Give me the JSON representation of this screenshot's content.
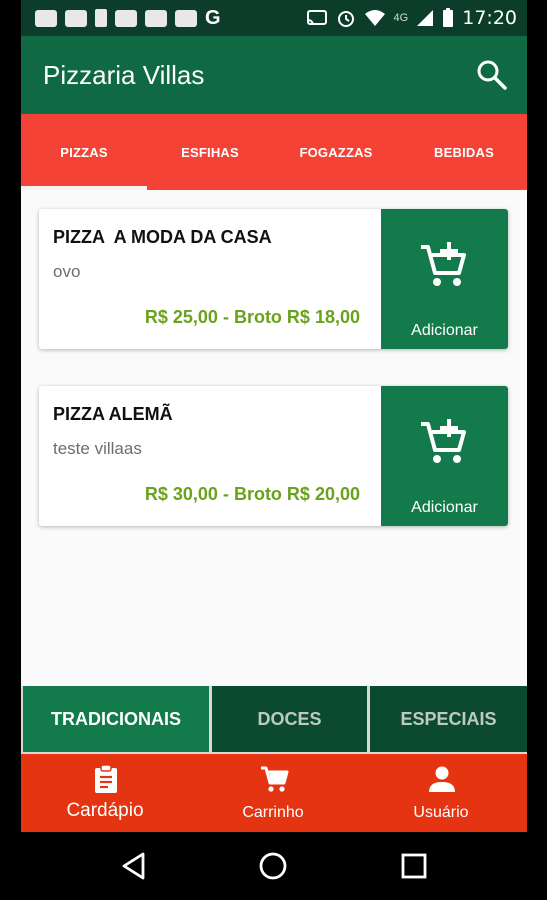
{
  "status_bar": {
    "network": "4G",
    "time": "17:20",
    "notification_letter": "G",
    "icons": [
      "message-icon",
      "news-icon",
      "phone-icon",
      "gallery-icon",
      "mail-icon",
      "gallery-icon",
      "google-icon",
      "cast-icon",
      "alarm-icon",
      "wifi-icon",
      "signal-icon",
      "battery-icon"
    ]
  },
  "app_bar": {
    "title": "Pizzaria Villas",
    "search_icon": "search-icon"
  },
  "tabs": {
    "items": [
      "PIZZAS",
      "ESFIHAS",
      "FOGAZZAS",
      "BEBIDAS"
    ],
    "selected": "PIZZAS"
  },
  "products": [
    {
      "name": "PIZZA  A MODA DA CASA",
      "description": "ovo",
      "price": "R$ 25,00 - Broto R$ 18,00",
      "action_label": "Adicionar",
      "action_icon": "add-shopping-cart-icon"
    },
    {
      "name": "PIZZA ALEMÃ",
      "description": "teste villaas",
      "price": "R$ 30,00 - Broto R$ 20,00",
      "action_label": "Adicionar",
      "action_icon": "add-shopping-cart-icon"
    }
  ],
  "categories": {
    "items": [
      "TRADICIONAIS",
      "DOCES",
      "ESPECIAIS"
    ],
    "selected": "TRADICIONAIS"
  },
  "bottom_nav": {
    "items": [
      {
        "label": "Cardápio",
        "icon": "menu-clipboard-icon"
      },
      {
        "label": "Carrinho",
        "icon": "cart-icon"
      },
      {
        "label": "Usuário",
        "icon": "user-icon"
      }
    ]
  },
  "colors": {
    "primary_dark": "#0b3d2a",
    "primary": "#0f6a44",
    "button_green": "#137a4c",
    "tab_red": "#f44336",
    "bottom_nav_red": "#e53412",
    "price_green": "#6aa11d"
  }
}
